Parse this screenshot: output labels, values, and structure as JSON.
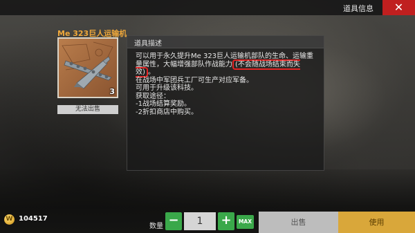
{
  "header": {
    "title": "道具信息",
    "close_label": "✕"
  },
  "item": {
    "name": "Me 323巨人运输机",
    "count": "3",
    "unsellable_label": "无法出售",
    "icon": "transport-plane-icon"
  },
  "description": {
    "title": "道具描述",
    "line1_before": "可以用于永久提升Me 323巨人运输机部队的生命、运输重量属性，大幅增强部队作战能力",
    "line1_highlight": "(不会随战场结束而失效)",
    "line1_after": "。",
    "line2": "在战场中军团兵工厂可生产对应军备。",
    "line3": "可用于升级该科技。",
    "line4": "获取途径：",
    "line5": "-1战场结算奖励。",
    "line6": "-2折扣商店中购买。"
  },
  "currency": {
    "icon_letter": "W",
    "amount": "104517"
  },
  "quantity": {
    "label": "数量",
    "minus": "−",
    "value": "1",
    "plus": "+",
    "max": "MAX"
  },
  "actions": {
    "sell": "出售",
    "use": "使用"
  },
  "colors": {
    "accent_green": "#3aa84a",
    "accent_gold": "#d9a73a",
    "close_red": "#c01f1f",
    "item_name_orange": "#f0a83a",
    "highlight_red": "#e52424"
  }
}
